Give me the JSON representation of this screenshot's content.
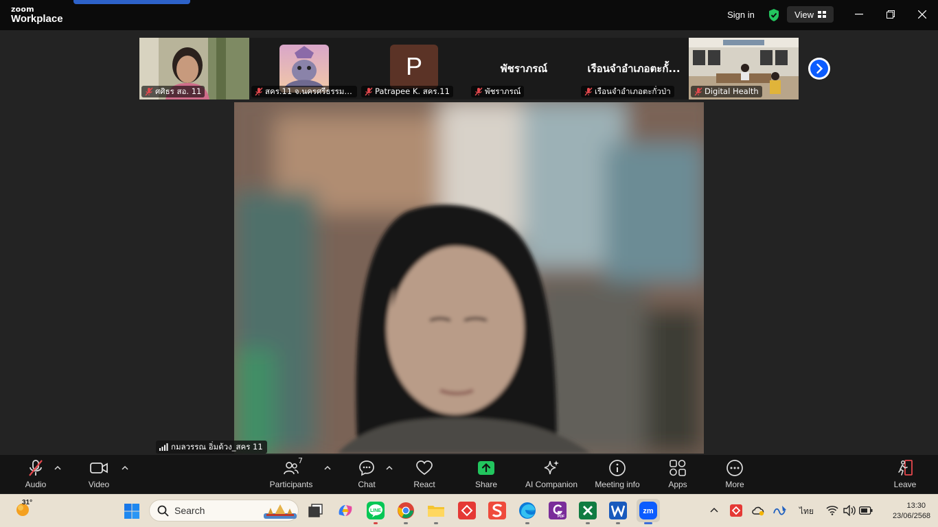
{
  "app": {
    "logo_top": "zoom",
    "logo_bottom": "Workplace",
    "sign_in": "Sign in",
    "view": "View"
  },
  "thumbnails": [
    {
      "label": "ศศิธร สอ. 11",
      "type": "video"
    },
    {
      "label": "สคร.11 จ.นครศรีธรรมรา...",
      "type": "avatar-image"
    },
    {
      "label": "Patrapee K. สคร.11",
      "type": "avatar-letter",
      "letter": "P"
    },
    {
      "label": "พัชราภรณ์",
      "type": "name",
      "big_name": "พัชราภรณ์"
    },
    {
      "label": "เรือนจำอำเภอตะกั่วป่า",
      "type": "name",
      "big_name": "เรือนจำอำเภอตะกั้..."
    },
    {
      "label": "Digital Health",
      "type": "video"
    }
  ],
  "main_speaker": {
    "name": "กมลวรรณ อิ่มด้วง_สคร 11"
  },
  "toolbar": {
    "audio": "Audio",
    "video": "Video",
    "participants": "Participants",
    "participants_count": "7",
    "chat": "Chat",
    "react": "React",
    "share": "Share",
    "ai_companion": "AI Companion",
    "meeting_info": "Meeting info",
    "apps": "Apps",
    "more": "More",
    "leave": "Leave"
  },
  "taskbar": {
    "temperature": "31°",
    "search_placeholder": "Search",
    "language": "ไทย",
    "time": "13:30",
    "date": "23/06/2568"
  },
  "colors": {
    "share_green": "#22c55e",
    "zoom_blue": "#0b5cff",
    "mute_red": "#e5484d"
  }
}
